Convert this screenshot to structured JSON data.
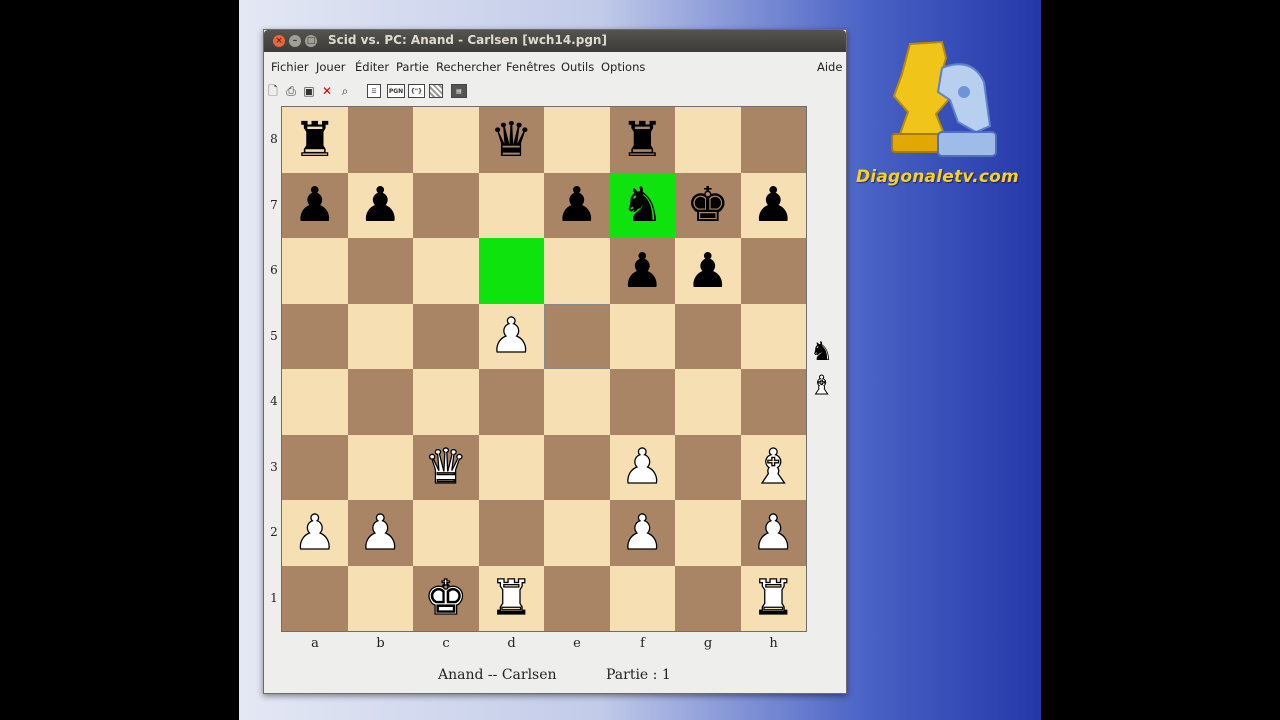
{
  "window": {
    "title": "Scid vs. PC: Anand - Carlsen [wch14.pgn]",
    "controls": {
      "close": "×",
      "minimize": "–",
      "maximize": "□"
    }
  },
  "menu": {
    "items": [
      "Fichier",
      "Jouer",
      "Éditer",
      "Partie",
      "Rechercher",
      "Fenêtres",
      "Outils",
      "Options"
    ],
    "help": "Aide"
  },
  "toolbar": {
    "icons": [
      "new-file-icon",
      "print-icon",
      "save-icon",
      "close-icon",
      "find-icon",
      "game-list-icon",
      "pgn-icon",
      "comment-icon",
      "board-icon",
      "tree-icon"
    ],
    "pgn_label": "PGN",
    "comment_label": "{\"}"
  },
  "board": {
    "ranks": [
      "8",
      "7",
      "6",
      "5",
      "4",
      "3",
      "2",
      "1"
    ],
    "files": [
      "a",
      "b",
      "c",
      "d",
      "e",
      "f",
      "g",
      "h"
    ],
    "rows": [
      [
        "br",
        "",
        "",
        "bq",
        "",
        "br",
        "",
        ""
      ],
      [
        "bp",
        "bp",
        "",
        "",
        "bp",
        "bn",
        "bk",
        "bp"
      ],
      [
        "",
        "",
        "",
        "",
        "",
        "bp",
        "bp",
        ""
      ],
      [
        "",
        "",
        "",
        "wp",
        "",
        "",
        "",
        ""
      ],
      [
        "",
        "",
        "",
        "",
        "",
        "",
        "",
        ""
      ],
      [
        "",
        "",
        "wq",
        "",
        "",
        "wp",
        "",
        "wb"
      ],
      [
        "wp",
        "wp",
        "",
        "",
        "",
        "wp",
        "",
        "wp"
      ],
      [
        "",
        "",
        "wk",
        "wr",
        "",
        "",
        "",
        "wr"
      ]
    ],
    "highlighted": [
      "d6",
      "f7"
    ],
    "selected": [
      "e5"
    ],
    "colors": {
      "light": "#f7dfb4",
      "dark": "#a98566",
      "highlight": "#0ee30e"
    }
  },
  "captured": [
    "bn",
    "wb"
  ],
  "footer": {
    "players": "Anand  --  Carlsen",
    "game_label": "Partie : 1"
  },
  "logo": {
    "text": "Diagonaletv.com"
  }
}
